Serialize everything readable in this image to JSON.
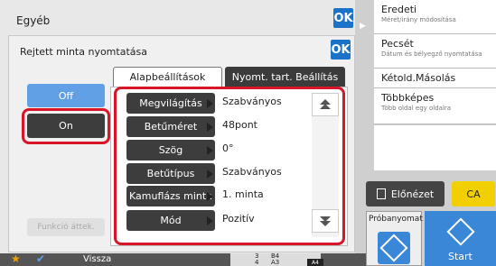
{
  "outer": {
    "title": "Egyéb",
    "ok": "OK"
  },
  "dialog": {
    "title": "Rejtett minta nyomtatása",
    "ok": "OK"
  },
  "tabs": [
    "Alapbeállítások",
    "Nyomt. tart. Beállítás"
  ],
  "toggle": {
    "off": "Off",
    "on": "On"
  },
  "funkcio": "Funkció áttek.",
  "settings": [
    {
      "label": "Megvilágítás",
      "value": "Szabványos"
    },
    {
      "label": "Betűméret",
      "value": "48pont"
    },
    {
      "label": "Szög",
      "value": "0°"
    },
    {
      "label": "Betűtípus",
      "value": "Szabványos"
    },
    {
      "label": "Kamuflázs minta",
      "value": "1. minta"
    },
    {
      "label": "Mód",
      "value": "Pozitív"
    }
  ],
  "right_menu": [
    {
      "title": "Eredeti",
      "sub": "Méret/irány módosítása"
    },
    {
      "title": "Pecsét",
      "sub": "Dátum és bélyegző nyomtatása"
    },
    {
      "title": "Kétold.Másolás",
      "sub": ""
    },
    {
      "title": "Többképes",
      "sub": "Több oldal egy oldalra"
    }
  ],
  "elonezet": "Előnézet",
  "ca": "CA",
  "probanyomat": "Próbanyomat",
  "start": "Start",
  "bottom": {
    "vissza": "Vissza",
    "paper": [
      {
        "n": "3",
        "s": "B4"
      },
      {
        "n": "4",
        "s": "A3"
      }
    ],
    "size_badge": "A4"
  },
  "colors": {
    "accent": "#1a73c8",
    "highlight": "#d9152a",
    "ca": "#f2d000"
  }
}
